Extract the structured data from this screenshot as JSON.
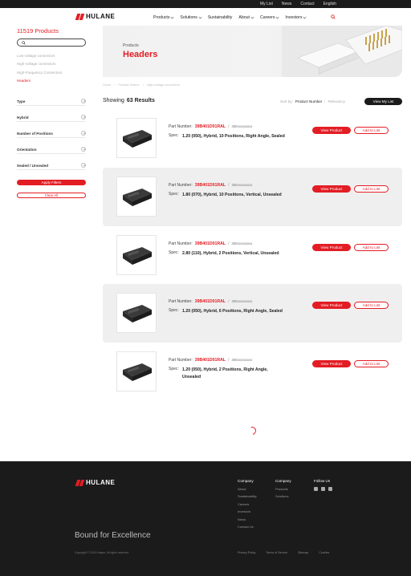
{
  "topbar": {
    "links": [
      "My List",
      "News",
      "Contact",
      "English"
    ]
  },
  "header": {
    "logo_text": "HULANE",
    "nav": [
      "Products",
      "Solutions",
      "Sustainability",
      "About",
      "Careers",
      "Investors"
    ]
  },
  "sidebar": {
    "count_title": "11519 Products",
    "categories": [
      "Low-voltage connectors",
      "High-voltage connectors",
      "High-Frequency Connectors",
      "Headers"
    ],
    "active_category": "Headers",
    "filters": [
      "Type",
      "Hybrid",
      "Number of Positions",
      "Orientation",
      "Sealed / Unsealed"
    ],
    "apply_label": "Apply Filters",
    "clear_label": "Clear All"
  },
  "banner": {
    "crumb": "Products",
    "title": "Headers"
  },
  "breadcrumb": [
    "Home",
    "Product Search",
    "High-voltage connectors"
  ],
  "results": {
    "showing_label": "Showing",
    "count_label": "63 Results",
    "sort_label": "Sort by:",
    "sort_options": [
      "Product Number",
      "Relevancy"
    ],
    "my_list_label": "View My List"
  },
  "products": [
    {
      "pn_label": "Part Number:",
      "pn": "39B401D01RAL",
      "alt": "350xxxxxxxxx",
      "spec_label": "Spec:",
      "spec": "1.20 (050), Hybrid, 10 Positions, Right Angle, Sealed",
      "view": "View Product",
      "add": "Add to List"
    },
    {
      "pn_label": "Part Number:",
      "pn": "39B401D01RAL",
      "alt": "350xxxxxxxxx",
      "spec_label": "Spec:",
      "spec": "1.80 (070), Hybrid, 10 Positions, Vertical, Unsealed",
      "view": "View Product",
      "add": "Add to List"
    },
    {
      "pn_label": "Part Number:",
      "pn": "39B401D01RAL",
      "alt": "350xxxxxxxxx",
      "spec_label": "Spec:",
      "spec": "2.80 (110), Hybrid, 2 Positions, Vertical, Unsealed",
      "view": "View Product",
      "add": "Add to List"
    },
    {
      "pn_label": "Part Number:",
      "pn": "39B401D01RAL",
      "alt": "350xxxxxxxxx",
      "spec_label": "Spec:",
      "spec": "1.20 (050), Hybrid, 6 Positions, Right Angle, Sealed",
      "view": "View Product",
      "add": "Add to List"
    },
    {
      "pn_label": "Part Number:",
      "pn": "39B401D01RAL",
      "alt": "350xxxxxxxxx",
      "spec_label": "Spec:",
      "spec": "1.20 (050), Hybrid, 2 Positions, Right Angle, Unsealed",
      "view": "View Product",
      "add": "Add to List"
    }
  ],
  "footer": {
    "logo_text": "HULANE",
    "company_heading": "Company",
    "company_links": [
      "About",
      "Sustainability",
      "Careers",
      "Investors",
      "News",
      "Contact Us"
    ],
    "company2_heading": "Company",
    "company2_links": [
      "Products",
      "Solutions"
    ],
    "follow_heading": "Follow Us",
    "social_icons": [
      "linkedin-icon",
      "wechat-icon",
      "youtube-icon"
    ],
    "slogan": "Bound for Excellence",
    "copyright": "Copyright © 2024 Hulane. All rights reserved.",
    "legal_links": [
      "Privacy Policy",
      "Terms of Service",
      "Sitemap",
      "Cookies"
    ]
  },
  "colors": {
    "accent": "#e31d24",
    "dark": "#1b1b1b",
    "shade": "#efefef"
  }
}
